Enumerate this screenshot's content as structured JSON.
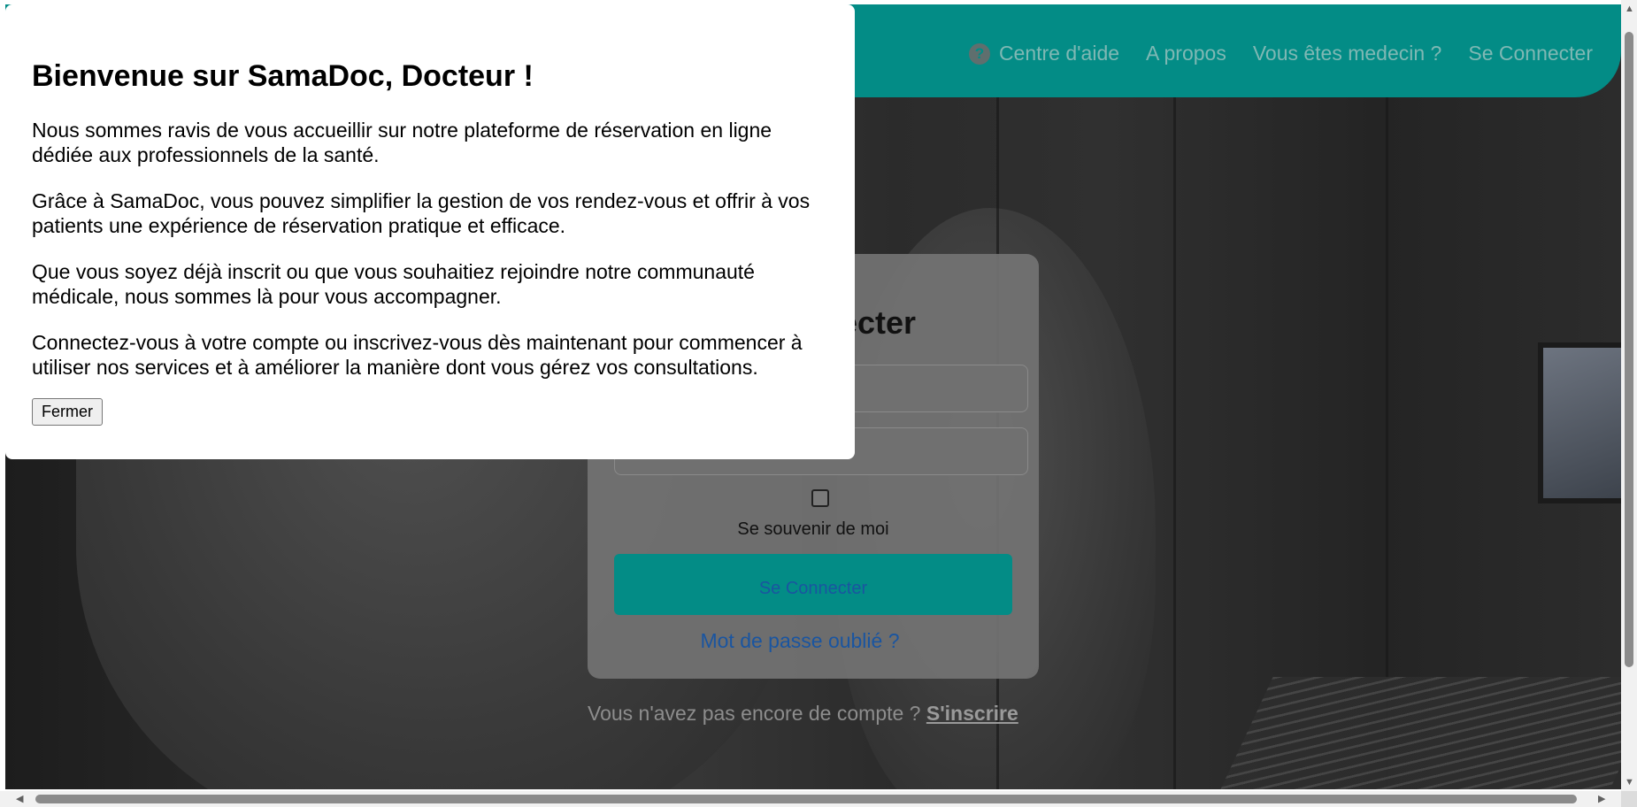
{
  "navbar": {
    "help_icon": "question-circle-icon",
    "links": [
      "Centre d'aide",
      "A propos",
      "Vous êtes medecin ?",
      "Se Connecter"
    ]
  },
  "login": {
    "title": "Se Connecter",
    "remember_label": "Se souvenir de moi",
    "submit_label": "Se Connecter",
    "forgot_link": "Mot de passe oublié ?",
    "no_account_text": "Vous n'avez pas encore de compte ?",
    "signup_link": "S'inscrire"
  },
  "modal": {
    "title": "Bienvenue sur SamaDoc, Docteur !",
    "paragraphs": [
      "Nous sommes ravis de vous accueillir sur notre plateforme de réservation en ligne dédiée aux professionnels de la santé.",
      "Grâce à SamaDoc, vous pouvez simplifier la gestion de vos rendez-vous et offrir à vos patients une expérience de réservation pratique et efficace.",
      "Que vous soyez déjà inscrit ou que vous souhaitiez rejoindre notre communauté médicale, nous sommes là pour vous accompagner.",
      "Connectez-vous à votre compte ou inscrivez-vous dès maintenant pour commencer à utiliser nos services et à améliorer la manière dont vous gérez vos consultations."
    ],
    "close_label": "Fermer"
  },
  "colors": {
    "brand_teal": "#038c86",
    "link_blue": "#1a55a0"
  }
}
